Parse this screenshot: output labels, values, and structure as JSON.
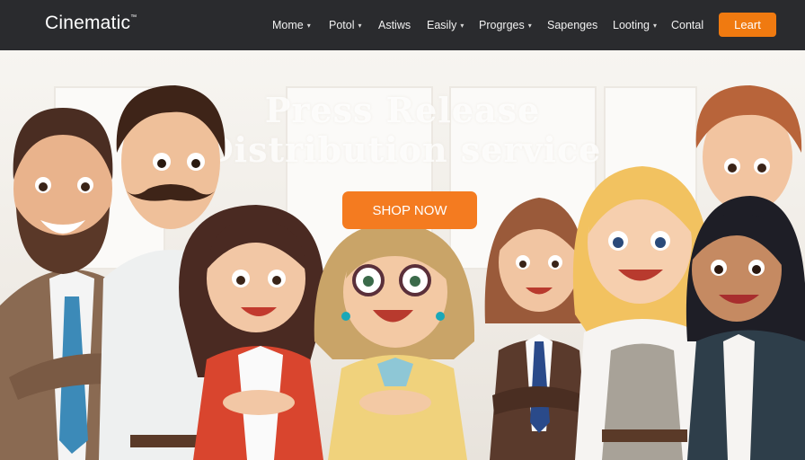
{
  "header": {
    "brand": "Cinematic",
    "brand_mark": "™",
    "menu": [
      {
        "label": "Mome",
        "dropdown": true
      },
      {
        "label": "Potol",
        "dropdown": true
      },
      {
        "label": "Astiws",
        "dropdown": false
      },
      {
        "label": "Easily",
        "dropdown": true
      },
      {
        "label": "Progrges",
        "dropdown": true
      },
      {
        "label": "Sapenges",
        "dropdown": false
      },
      {
        "label": "Looting",
        "dropdown": true
      },
      {
        "label": "Contal",
        "dropdown": false
      }
    ],
    "cta_label": "Leart",
    "chevron": "▾"
  },
  "hero": {
    "headline_line1": "Press Release",
    "headline_line2": "Distribution service",
    "button_label": "SHOP NOW"
  },
  "colors": {
    "nav_bg": "#2a2b2e",
    "accent": "#f47b20"
  }
}
